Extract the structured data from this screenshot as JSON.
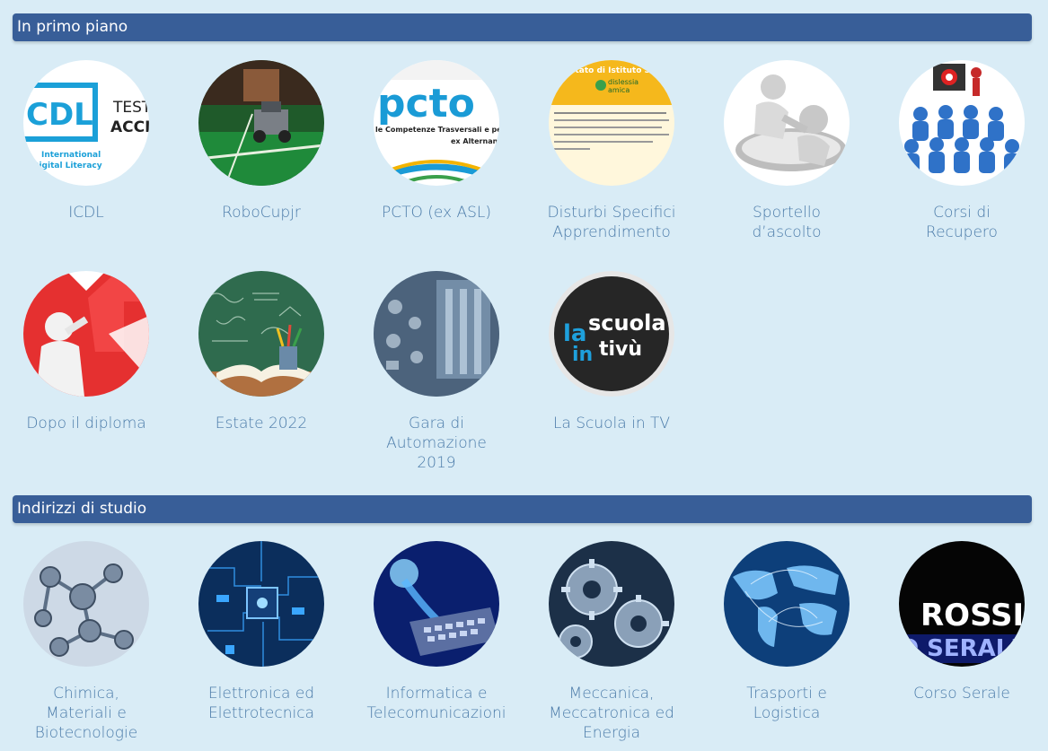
{
  "sections": [
    {
      "title": "In primo piano",
      "items": [
        {
          "label": "ICDL",
          "logo_text": [
            "TEST",
            "ACCI"
          ],
          "caption": "International\nDigital Literacy",
          "mark": "CDL"
        },
        {
          "label": "RoboCupjr"
        },
        {
          "label": "PCTO (ex ASL)",
          "logo_text": "pcto",
          "sub_text": [
            "le Competenze Trasversali e per",
            "ex Alternanz"
          ]
        },
        {
          "label": "Disturbi Specifici\nApprendimento",
          "header_text": "estato di Istituto Scol",
          "logo_text": [
            "dislessia",
            "amica"
          ]
        },
        {
          "label": "Sportello\nd’ascolto"
        },
        {
          "label": "Corsi di\nRecupero"
        },
        {
          "label": "Dopo il diploma"
        },
        {
          "label": "Estate 2022"
        },
        {
          "label": "Gara di\nAutomazione\n2019"
        },
        {
          "label": "La Scuola in TV",
          "logo_text": [
            "la",
            "scuola",
            "in",
            "tivù"
          ]
        }
      ]
    },
    {
      "title": "Indirizzi di studio",
      "items": [
        {
          "label": "Chimica,\nMateriali e\nBiotecnologie"
        },
        {
          "label": "Elettronica ed\nElettrotecnica"
        },
        {
          "label": "Informatica e\nTelecomunicazioni"
        },
        {
          "label": "Meccanica,\nMeccatronica ed\nEnergia"
        },
        {
          "label": "Trasporti e\nLogistica"
        },
        {
          "label": "Corso Serale",
          "logo_text": [
            "ROSSI",
            "O SERALE"
          ]
        }
      ]
    }
  ],
  "colors": {
    "bar": "#385e98",
    "label": "#4b7ba9",
    "background": "#d9ecf6"
  }
}
